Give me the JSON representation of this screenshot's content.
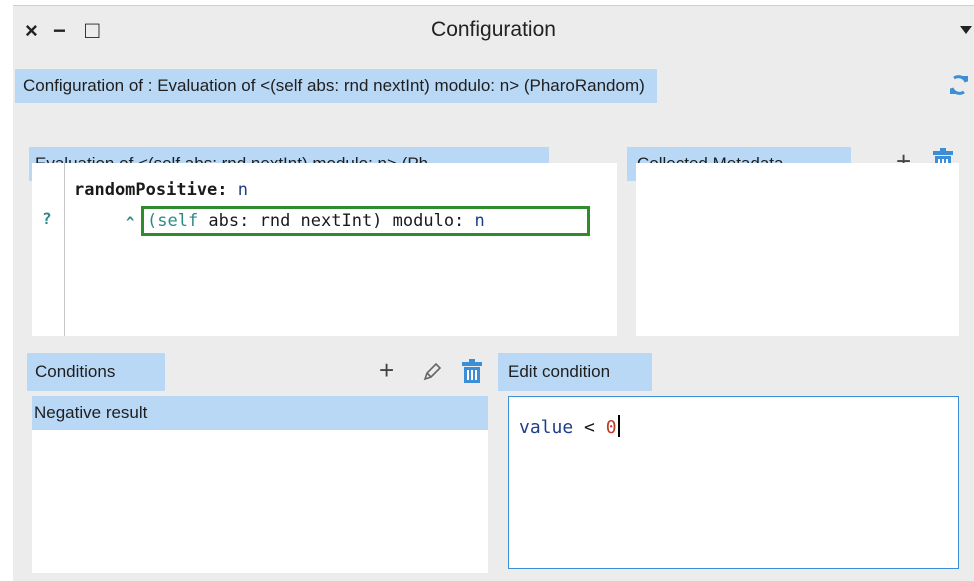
{
  "window": {
    "title": "Configuration",
    "close_glyph": "×",
    "minimize_glyph": "−",
    "maximize_glyph": "□"
  },
  "header_tab": {
    "label": "Configuration of : Evaluation of <(self abs: rnd nextInt) modulo: n> (PharoRandom)"
  },
  "source_tab": {
    "label": "Evaluation of <(self abs: rnd nextInt) modulo: n> (Ph..."
  },
  "source_code": {
    "method_selector": "randomPositive:",
    "method_arg": "n",
    "caret_glyph": "^",
    "body_part1": "(self",
    "body_part2": " abs: rnd nextInt) modulo: ",
    "body_arg": "n",
    "gutter_marker": "?"
  },
  "metadata": {
    "tab_label": "Collected Metadata",
    "add_glyph": "+"
  },
  "conditions": {
    "tab_label": "Conditions",
    "add_glyph": "+",
    "items": [
      {
        "label": "Negative result",
        "selected": true
      }
    ]
  },
  "edit_condition": {
    "tab_label": "Edit condition",
    "code_value": "value",
    "code_op": " < ",
    "code_number": "0"
  },
  "colors": {
    "tab_bg": "#b9d8f6",
    "selection_bg": "#b9d8f6",
    "highlight_border": "#2e8b2e",
    "trash_icon": "#3c8fd6"
  }
}
